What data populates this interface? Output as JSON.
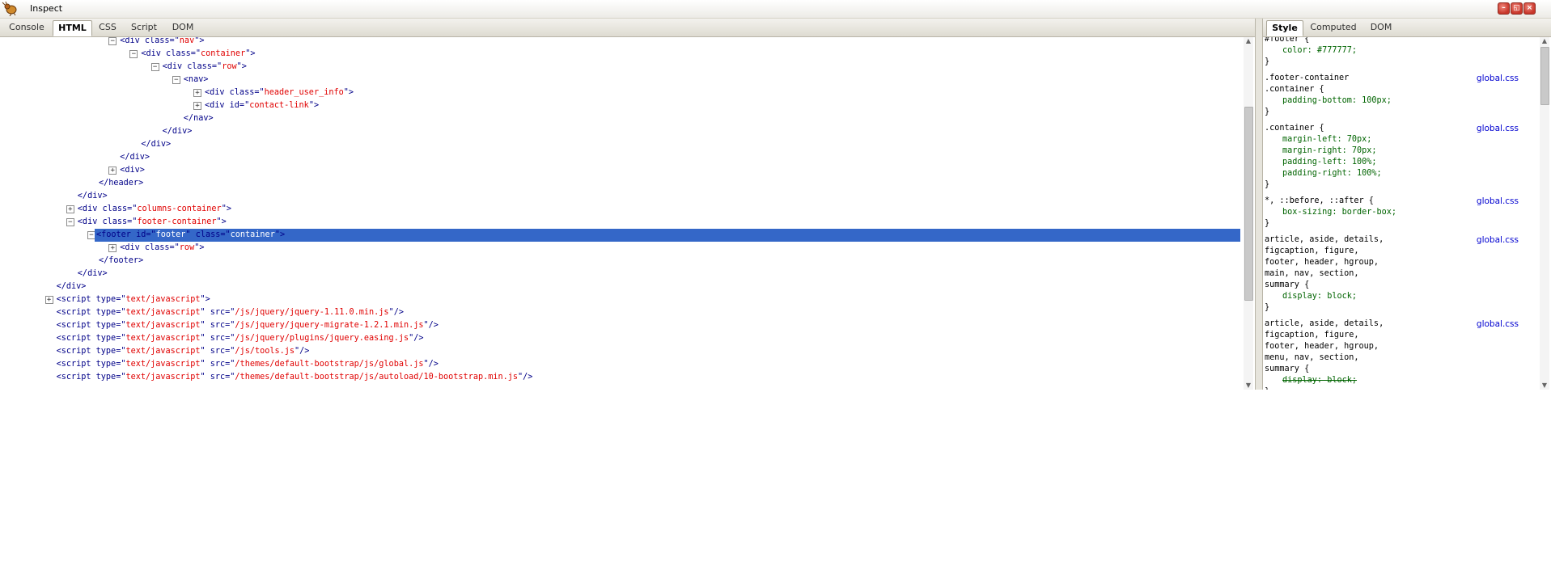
{
  "window": {
    "title": "Inspect",
    "controls": [
      "minimize",
      "restore",
      "close"
    ]
  },
  "tabs": {
    "left": [
      {
        "label": "Console"
      },
      {
        "label": "HTML",
        "active": true
      },
      {
        "label": "CSS"
      },
      {
        "label": "Script"
      },
      {
        "label": "DOM"
      }
    ],
    "right": [
      {
        "label": "Style",
        "active": true
      },
      {
        "label": "Computed"
      },
      {
        "label": "DOM"
      }
    ]
  },
  "html_tree": [
    {
      "indent": 6,
      "toggle": "minus",
      "parts": [
        [
          "<div class=\"",
          "a"
        ],
        [
          "nav",
          "v"
        ],
        [
          "\">",
          "a"
        ]
      ]
    },
    {
      "indent": 7,
      "toggle": "minus",
      "parts": [
        [
          "<div class=\"",
          "a"
        ],
        [
          "container",
          "v"
        ],
        [
          "\">",
          "a"
        ]
      ]
    },
    {
      "indent": 8,
      "toggle": "minus",
      "parts": [
        [
          "<div class=\"",
          "a"
        ],
        [
          "row",
          "v"
        ],
        [
          "\">",
          "a"
        ]
      ]
    },
    {
      "indent": 9,
      "toggle": "minus",
      "parts": [
        [
          "<nav>",
          "a"
        ]
      ]
    },
    {
      "indent": 10,
      "toggle": "plus",
      "parts": [
        [
          "<div class=\"",
          "a"
        ],
        [
          "header_user_info",
          "v"
        ],
        [
          "\">",
          "a"
        ]
      ]
    },
    {
      "indent": 10,
      "toggle": "plus",
      "parts": [
        [
          "<div id=\"",
          "a"
        ],
        [
          "contact-link",
          "v"
        ],
        [
          "\">",
          "a"
        ]
      ]
    },
    {
      "indent": 9,
      "toggle": null,
      "parts": [
        [
          "</nav>",
          "a"
        ]
      ]
    },
    {
      "indent": 8,
      "toggle": null,
      "parts": [
        [
          "</div>",
          "a"
        ]
      ]
    },
    {
      "indent": 7,
      "toggle": null,
      "parts": [
        [
          "</div>",
          "a"
        ]
      ]
    },
    {
      "indent": 6,
      "toggle": null,
      "parts": [
        [
          "</div>",
          "a"
        ]
      ]
    },
    {
      "indent": 6,
      "toggle": "plus",
      "parts": [
        [
          "<div>",
          "a"
        ]
      ]
    },
    {
      "indent": 5,
      "toggle": null,
      "parts": [
        [
          "</header>",
          "a"
        ]
      ]
    },
    {
      "indent": 4,
      "toggle": null,
      "parts": [
        [
          "</div>",
          "a"
        ]
      ]
    },
    {
      "indent": 4,
      "toggle": "plus",
      "parts": [
        [
          "<div class=\"",
          "a"
        ],
        [
          "columns-container",
          "v"
        ],
        [
          "\">",
          "a"
        ]
      ]
    },
    {
      "indent": 4,
      "toggle": "minus",
      "parts": [
        [
          "<div class=\"",
          "a"
        ],
        [
          "footer-container",
          "v"
        ],
        [
          "\">",
          "a"
        ]
      ]
    },
    {
      "indent": 5,
      "toggle": "minus",
      "selected": true,
      "parts": [
        [
          "<footer id=\"",
          "a"
        ],
        [
          "footer",
          "v"
        ],
        [
          "\" class=\"",
          "a"
        ],
        [
          "container",
          "v"
        ],
        [
          "\">",
          "a"
        ]
      ]
    },
    {
      "indent": 6,
      "toggle": "plus",
      "parts": [
        [
          "<div class=\"",
          "a"
        ],
        [
          "row",
          "v"
        ],
        [
          "\">",
          "a"
        ]
      ]
    },
    {
      "indent": 5,
      "toggle": null,
      "parts": [
        [
          "</footer>",
          "a"
        ]
      ]
    },
    {
      "indent": 4,
      "toggle": null,
      "parts": [
        [
          "</div>",
          "a"
        ]
      ]
    },
    {
      "indent": 3,
      "toggle": null,
      "parts": [
        [
          "</div>",
          "a"
        ]
      ]
    },
    {
      "indent": 3,
      "toggle": "plus",
      "parts": [
        [
          "<script type=\"",
          "a"
        ],
        [
          "text/javascript",
          "v"
        ],
        [
          "\">",
          "a"
        ]
      ]
    },
    {
      "indent": 3,
      "toggle": null,
      "parts": [
        [
          "<script type=\"",
          "a"
        ],
        [
          "text/javascript",
          "v"
        ],
        [
          "\" src=\"",
          "a"
        ],
        [
          "/js/jquery/jquery-1.11.0.min.js",
          "v"
        ],
        [
          "\"/>",
          "a"
        ]
      ]
    },
    {
      "indent": 3,
      "toggle": null,
      "parts": [
        [
          "<script type=\"",
          "a"
        ],
        [
          "text/javascript",
          "v"
        ],
        [
          "\" src=\"",
          "a"
        ],
        [
          "/js/jquery/jquery-migrate-1.2.1.min.js",
          "v"
        ],
        [
          "\"/>",
          "a"
        ]
      ]
    },
    {
      "indent": 3,
      "toggle": null,
      "parts": [
        [
          "<script type=\"",
          "a"
        ],
        [
          "text/javascript",
          "v"
        ],
        [
          "\" src=\"",
          "a"
        ],
        [
          "/js/jquery/plugins/jquery.easing.js",
          "v"
        ],
        [
          "\"/>",
          "a"
        ]
      ]
    },
    {
      "indent": 3,
      "toggle": null,
      "parts": [
        [
          "<script type=\"",
          "a"
        ],
        [
          "text/javascript",
          "v"
        ],
        [
          "\" src=\"",
          "a"
        ],
        [
          "/js/tools.js",
          "v"
        ],
        [
          "\"/>",
          "a"
        ]
      ]
    },
    {
      "indent": 3,
      "toggle": null,
      "parts": [
        [
          "<script type=\"",
          "a"
        ],
        [
          "text/javascript",
          "v"
        ],
        [
          "\" src=\"",
          "a"
        ],
        [
          "/themes/default-bootstrap/js/global.js",
          "v"
        ],
        [
          "\"/>",
          "a"
        ]
      ]
    },
    {
      "indent": 3,
      "toggle": null,
      "parts": [
        [
          "<script type=\"",
          "a"
        ],
        [
          "text/javascript",
          "v"
        ],
        [
          "\" src=\"",
          "a"
        ],
        [
          "/themes/default-bootstrap/js/autoload/10-bootstrap.min.js",
          "v"
        ],
        [
          "\"/>",
          "a"
        ]
      ]
    }
  ],
  "style_rules": [
    {
      "selector": [
        "#footer {"
      ],
      "props": [
        [
          "color: #777777;",
          false
        ]
      ],
      "source": ""
    },
    {
      "selector": [
        ".footer-container",
        ".container {"
      ],
      "props": [
        [
          "padding-bottom: 100px;",
          false
        ]
      ],
      "source": "global.css"
    },
    {
      "selector": [
        ".container {"
      ],
      "props": [
        [
          "margin-left: 70px;",
          false
        ],
        [
          "margin-right: 70px;",
          false
        ],
        [
          "padding-left: 100%;",
          false
        ],
        [
          "padding-right: 100%;",
          false
        ]
      ],
      "source": "global.css"
    },
    {
      "selector": [
        "*, ::before, ::after {"
      ],
      "props": [
        [
          "box-sizing: border-box;",
          false
        ]
      ],
      "source": "global.css"
    },
    {
      "selector": [
        "article, aside, details,",
        "figcaption, figure,",
        "footer, header, hgroup,",
        "main, nav, section,",
        "summary {"
      ],
      "props": [
        [
          "display: block;",
          false
        ]
      ],
      "source": "global.css"
    },
    {
      "selector": [
        "article, aside, details,",
        "figcaption, figure,",
        "footer, header, hgroup,",
        "menu, nav, section,",
        "summary {"
      ],
      "props": [
        [
          "display: block;",
          true
        ]
      ],
      "source": "global.css"
    }
  ]
}
